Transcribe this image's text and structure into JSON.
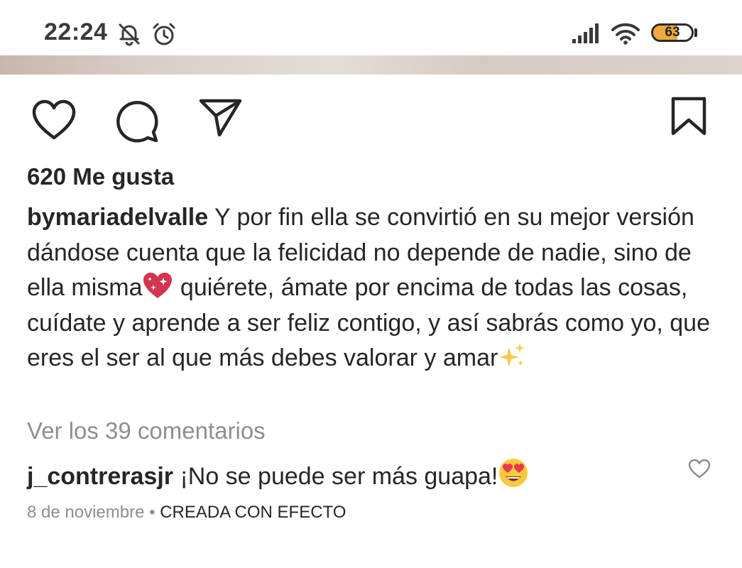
{
  "status_bar": {
    "time": "22:24",
    "battery_level": "63",
    "battery_fill_fraction": 0.63,
    "icons": [
      "mute-icon",
      "alarm-icon",
      "signal-icon",
      "wifi-icon",
      "battery-icon"
    ],
    "battery_fill_color": "#f2a93b"
  },
  "actions": {
    "icons": [
      "heart-icon",
      "comment-icon",
      "share-icon",
      "bookmark-icon"
    ]
  },
  "post": {
    "likes": "620 Me gusta",
    "username": "bymariadelvalle",
    "caption_part1": "Y por fin ella se convirtió en su mejor versión dándose cuenta que la felicidad no depende de nadie, sino de ella misma",
    "caption_emoji1": "sparkling-heart-emoji",
    "caption_part2": " quiérete, ámate por encima de todas las cosas, cuídate y aprende a ser feliz contigo, y así sabrás como yo, que eres el ser al que más debes valorar y amar",
    "caption_emoji2": "sparkles-emoji",
    "view_comments": "Ver los 39 comentarios",
    "comment": {
      "username": "j_contrerasjr",
      "text": "¡No se puede ser más guapa!",
      "emoji": "heart-eyes-emoji"
    },
    "date": "8 de noviembre",
    "separator": " • ",
    "effect_label": "CREADA CON EFECTO"
  },
  "colors": {
    "text": "#262626",
    "muted": "#8e8e8e",
    "heart_emoji": "#d4344f"
  }
}
